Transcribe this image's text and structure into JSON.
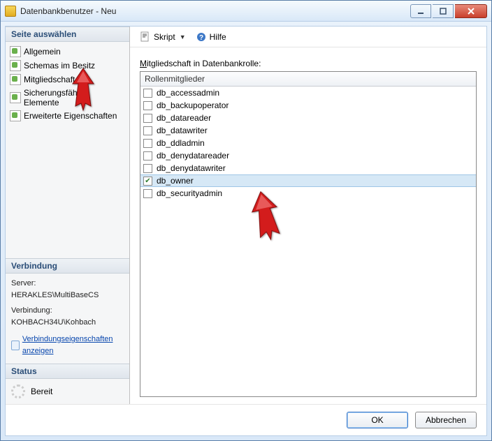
{
  "window": {
    "title": "Datenbankbenutzer - Neu"
  },
  "sidebar": {
    "pages_header": "Seite auswählen",
    "pages": [
      {
        "label": "Allgemein"
      },
      {
        "label": "Schemas im Besitz"
      },
      {
        "label": "Mitgliedschaft"
      },
      {
        "label": "Sicherungsfähige Elemente"
      },
      {
        "label": "Erweiterte Eigenschaften"
      }
    ],
    "connection_header": "Verbindung",
    "server_label": "Server:",
    "server_value": "HERAKLES\\MultiBaseCS",
    "conn_label": "Verbindung:",
    "conn_value": "KOHBACH34U\\Kohbach",
    "conn_props_link": "Verbindungseigenschaften anzeigen",
    "status_header": "Status",
    "status_text": "Bereit"
  },
  "toolbar": {
    "script_label": "Skript",
    "help_label": "Hilfe"
  },
  "content": {
    "membership_label_prefix": "M",
    "membership_label_rest": "itgliedschaft in Datenbankrolle:",
    "list_header": "Rollenmitglieder",
    "roles": [
      {
        "name": "db_accessadmin",
        "checked": false
      },
      {
        "name": "db_backupoperator",
        "checked": false
      },
      {
        "name": "db_datareader",
        "checked": false
      },
      {
        "name": "db_datawriter",
        "checked": false
      },
      {
        "name": "db_ddladmin",
        "checked": false
      },
      {
        "name": "db_denydatareader",
        "checked": false
      },
      {
        "name": "db_denydatawriter",
        "checked": false
      },
      {
        "name": "db_owner",
        "checked": true,
        "selected": true
      },
      {
        "name": "db_securityadmin",
        "checked": false
      }
    ]
  },
  "footer": {
    "ok_label": "OK",
    "cancel_label": "Abbrechen"
  }
}
